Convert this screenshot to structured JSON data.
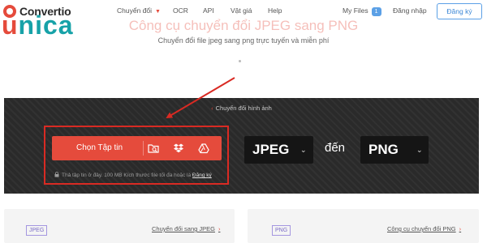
{
  "header": {
    "brand": "Convertio",
    "nav": [
      "Chuyển đổi",
      "OCR",
      "API",
      "Vật giá",
      "Help"
    ],
    "my_files_label": "My Files",
    "my_files_count": "1",
    "login": "Đăng nhập",
    "signup": "Đăng ký"
  },
  "hero": {
    "title": "Công cụ chuyển đổi JPEG sang PNG",
    "subtitle": "Chuyển đổi file jpeg sang png trực tuyến và miễn phí",
    "watermark_u": "u",
    "watermark_rest": "nica"
  },
  "converter": {
    "breadcrumb": "Chuyển đổi hình ảnh",
    "choose_files": "Chọn Tập tin",
    "drop_hint": "Thả tập tin ở đây. 100 MB Kích thước file tối đa hoặc là",
    "signup_link": "Đăng ký",
    "from_format": "JPEG",
    "to_word": "đến",
    "to_format": "PNG"
  },
  "cards": [
    {
      "tag": "JPEG",
      "link": "Chuyển đổi sang JPEG"
    },
    {
      "tag": "PNG",
      "link": "Công cụ chuyển đổi PNG"
    }
  ],
  "colors": {
    "accent": "#e54b3c",
    "panel": "#2a2a2a",
    "annotation": "#d92a23",
    "link_blue": "#3b87d6"
  },
  "icons": [
    "logo-icon",
    "chevron-down-icon",
    "folder-search-icon",
    "dropbox-icon",
    "google-drive-icon",
    "lock-icon",
    "chevron-left-icon",
    "chevron-right-icon"
  ]
}
